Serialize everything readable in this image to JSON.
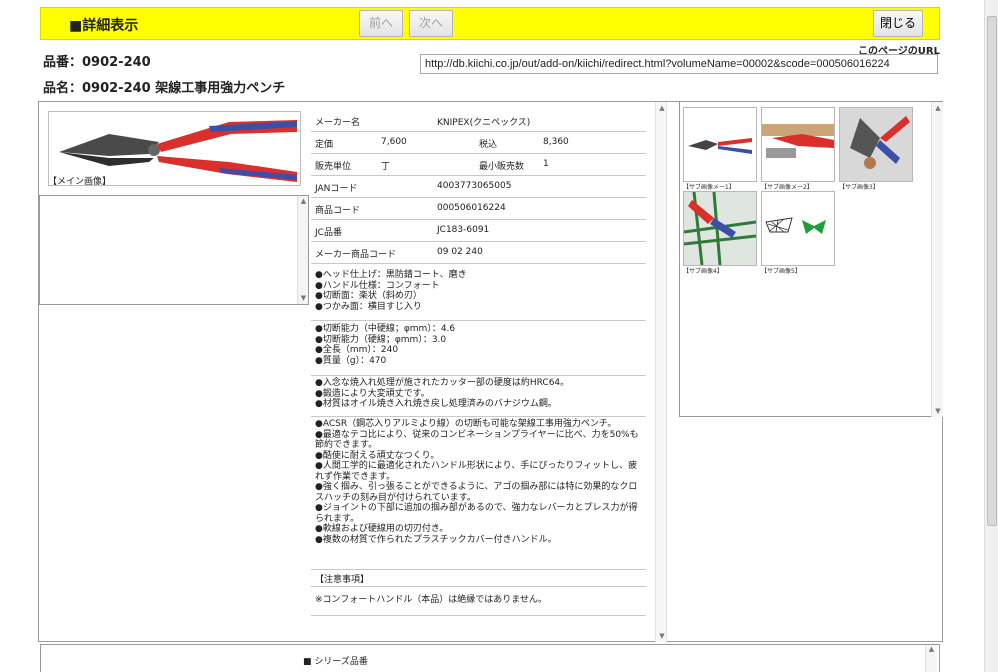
{
  "header": {
    "title": "■詳細表示",
    "prev_label": "前へ",
    "next_label": "次へ",
    "close_label": "閉じる"
  },
  "url": {
    "label": "このページのURL",
    "value": "http://db.kiichi.co.jp/out/add-on/kiichi/redirect.html?volumeName=00002&scode=000506016224"
  },
  "product": {
    "hinban": "品番：0902-240",
    "hinmei": "品名：0902-240 架線工事用強力ペンチ"
  },
  "main_image": {
    "caption": "【メイン画像】"
  },
  "spec": {
    "maker_label": "メーカー名",
    "maker_value": "KNIPEX(クニペックス)",
    "price_label": "定価",
    "price_value": "7,600",
    "tax_label": "税込",
    "tax_value": "8,360",
    "unit_label": "販売単位",
    "unit_value": "丁",
    "min_label": "最小販売数",
    "min_value": "1",
    "jan_label": "JANコード",
    "jan_value": "4003773065005",
    "code_label": "商品コード",
    "code_value": "000506016224",
    "jc_label": "JC品番",
    "jc_value": "JC183-6091",
    "maker_code_label": "メーカー商品コード",
    "maker_code_value": "09 02 240"
  },
  "features_a": [
    "●ヘッド仕上げ：黒防錆コート、磨き",
    "●ハンドル仕様：コンフォート",
    "●切断面：楽状（斜め刃）",
    "●つかみ面：横目すじ入り"
  ],
  "features_b": [
    "●切断能力（中硬線；φmm）：4.6",
    "●切断能力（硬線；φmm）：3.0",
    "●全長（mm）：240",
    "●質量（g）：470"
  ],
  "features_c": [
    "●入念な焼入れ処理が施されたカッター部の硬度は約HRC64。",
    "●鍛造により大変頑丈です。",
    "●材質はオイル焼き入れ焼き戻し処理済みのバナジウム鋼。"
  ],
  "features_d": [
    "●ACSR（鋼芯入りアルミより線）の切断も可能な架線工事用強力ペンチ。",
    "●最適なテコ比により、従来のコンビネーションプライヤーに比べ、力を50%も節約できます。",
    "●酷使に耐える頑丈なつくり。",
    "●人間工学的に最適化されたハンドル形状により、手にぴったりフィットし、疲れず作業できます。",
    "●強く掴み、引っ張ることができるように、アゴの掴み部には特に効果的なクロスハッチの刻み目が付けられています。",
    "●ジョイントの下部に追加の掴み部があるので、強力なレバーカとプレス力が得られます。",
    "●軟線および硬線用の切刃付き。",
    "●複数の材質で作られたプラスチックカバー付きハンドル。"
  ],
  "notes": {
    "title": "【注意事項】",
    "text": "※コンフォートハンドル（本品）は絶縁ではありません。"
  },
  "sub_images": [
    {
      "caption": "【サブ画像メー1】"
    },
    {
      "caption": "【サブ画像メー2】"
    },
    {
      "caption": "【サブ画像3】"
    },
    {
      "caption": "【サブ画像4】"
    },
    {
      "caption": "【サブ画像5】"
    }
  ],
  "series": {
    "label": "■ シリーズ品番"
  },
  "colors": {
    "header_bg": "#ffff00",
    "handle_red": "#d9302b",
    "handle_blue": "#3b4fa8",
    "tag_green": "#1e9e3a"
  }
}
